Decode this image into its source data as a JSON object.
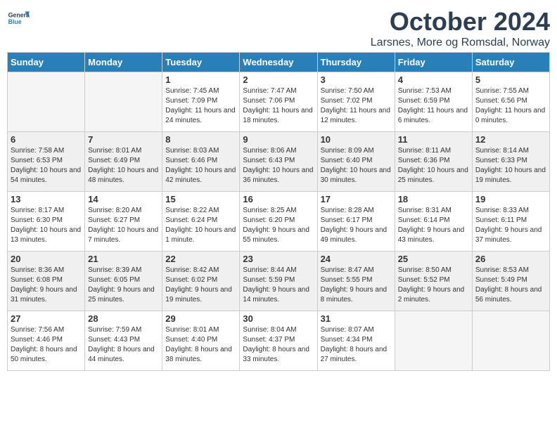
{
  "header": {
    "logo_general": "General",
    "logo_blue": "Blue",
    "month_title": "October 2024",
    "location": "Larsnes, More og Romsdal, Norway"
  },
  "days_of_week": [
    "Sunday",
    "Monday",
    "Tuesday",
    "Wednesday",
    "Thursday",
    "Friday",
    "Saturday"
  ],
  "weeks": [
    [
      {
        "day": "",
        "info": ""
      },
      {
        "day": "",
        "info": ""
      },
      {
        "day": "1",
        "info": "Sunrise: 7:45 AM\nSunset: 7:09 PM\nDaylight: 11 hours\nand 24 minutes."
      },
      {
        "day": "2",
        "info": "Sunrise: 7:47 AM\nSunset: 7:06 PM\nDaylight: 11 hours\nand 18 minutes."
      },
      {
        "day": "3",
        "info": "Sunrise: 7:50 AM\nSunset: 7:02 PM\nDaylight: 11 hours\nand 12 minutes."
      },
      {
        "day": "4",
        "info": "Sunrise: 7:53 AM\nSunset: 6:59 PM\nDaylight: 11 hours\nand 6 minutes."
      },
      {
        "day": "5",
        "info": "Sunrise: 7:55 AM\nSunset: 6:56 PM\nDaylight: 11 hours\nand 0 minutes."
      }
    ],
    [
      {
        "day": "6",
        "info": "Sunrise: 7:58 AM\nSunset: 6:53 PM\nDaylight: 10 hours\nand 54 minutes."
      },
      {
        "day": "7",
        "info": "Sunrise: 8:01 AM\nSunset: 6:49 PM\nDaylight: 10 hours\nand 48 minutes."
      },
      {
        "day": "8",
        "info": "Sunrise: 8:03 AM\nSunset: 6:46 PM\nDaylight: 10 hours\nand 42 minutes."
      },
      {
        "day": "9",
        "info": "Sunrise: 8:06 AM\nSunset: 6:43 PM\nDaylight: 10 hours\nand 36 minutes."
      },
      {
        "day": "10",
        "info": "Sunrise: 8:09 AM\nSunset: 6:40 PM\nDaylight: 10 hours\nand 30 minutes."
      },
      {
        "day": "11",
        "info": "Sunrise: 8:11 AM\nSunset: 6:36 PM\nDaylight: 10 hours\nand 25 minutes."
      },
      {
        "day": "12",
        "info": "Sunrise: 8:14 AM\nSunset: 6:33 PM\nDaylight: 10 hours\nand 19 minutes."
      }
    ],
    [
      {
        "day": "13",
        "info": "Sunrise: 8:17 AM\nSunset: 6:30 PM\nDaylight: 10 hours\nand 13 minutes."
      },
      {
        "day": "14",
        "info": "Sunrise: 8:20 AM\nSunset: 6:27 PM\nDaylight: 10 hours\nand 7 minutes."
      },
      {
        "day": "15",
        "info": "Sunrise: 8:22 AM\nSunset: 6:24 PM\nDaylight: 10 hours\nand 1 minute."
      },
      {
        "day": "16",
        "info": "Sunrise: 8:25 AM\nSunset: 6:20 PM\nDaylight: 9 hours\nand 55 minutes."
      },
      {
        "day": "17",
        "info": "Sunrise: 8:28 AM\nSunset: 6:17 PM\nDaylight: 9 hours\nand 49 minutes."
      },
      {
        "day": "18",
        "info": "Sunrise: 8:31 AM\nSunset: 6:14 PM\nDaylight: 9 hours\nand 43 minutes."
      },
      {
        "day": "19",
        "info": "Sunrise: 8:33 AM\nSunset: 6:11 PM\nDaylight: 9 hours\nand 37 minutes."
      }
    ],
    [
      {
        "day": "20",
        "info": "Sunrise: 8:36 AM\nSunset: 6:08 PM\nDaylight: 9 hours\nand 31 minutes."
      },
      {
        "day": "21",
        "info": "Sunrise: 8:39 AM\nSunset: 6:05 PM\nDaylight: 9 hours\nand 25 minutes."
      },
      {
        "day": "22",
        "info": "Sunrise: 8:42 AM\nSunset: 6:02 PM\nDaylight: 9 hours\nand 19 minutes."
      },
      {
        "day": "23",
        "info": "Sunrise: 8:44 AM\nSunset: 5:59 PM\nDaylight: 9 hours\nand 14 minutes."
      },
      {
        "day": "24",
        "info": "Sunrise: 8:47 AM\nSunset: 5:55 PM\nDaylight: 9 hours\nand 8 minutes."
      },
      {
        "day": "25",
        "info": "Sunrise: 8:50 AM\nSunset: 5:52 PM\nDaylight: 9 hours\nand 2 minutes."
      },
      {
        "day": "26",
        "info": "Sunrise: 8:53 AM\nSunset: 5:49 PM\nDaylight: 8 hours\nand 56 minutes."
      }
    ],
    [
      {
        "day": "27",
        "info": "Sunrise: 7:56 AM\nSunset: 4:46 PM\nDaylight: 8 hours\nand 50 minutes."
      },
      {
        "day": "28",
        "info": "Sunrise: 7:59 AM\nSunset: 4:43 PM\nDaylight: 8 hours\nand 44 minutes."
      },
      {
        "day": "29",
        "info": "Sunrise: 8:01 AM\nSunset: 4:40 PM\nDaylight: 8 hours\nand 38 minutes."
      },
      {
        "day": "30",
        "info": "Sunrise: 8:04 AM\nSunset: 4:37 PM\nDaylight: 8 hours\nand 33 minutes."
      },
      {
        "day": "31",
        "info": "Sunrise: 8:07 AM\nSunset: 4:34 PM\nDaylight: 8 hours\nand 27 minutes."
      },
      {
        "day": "",
        "info": ""
      },
      {
        "day": "",
        "info": ""
      }
    ]
  ]
}
